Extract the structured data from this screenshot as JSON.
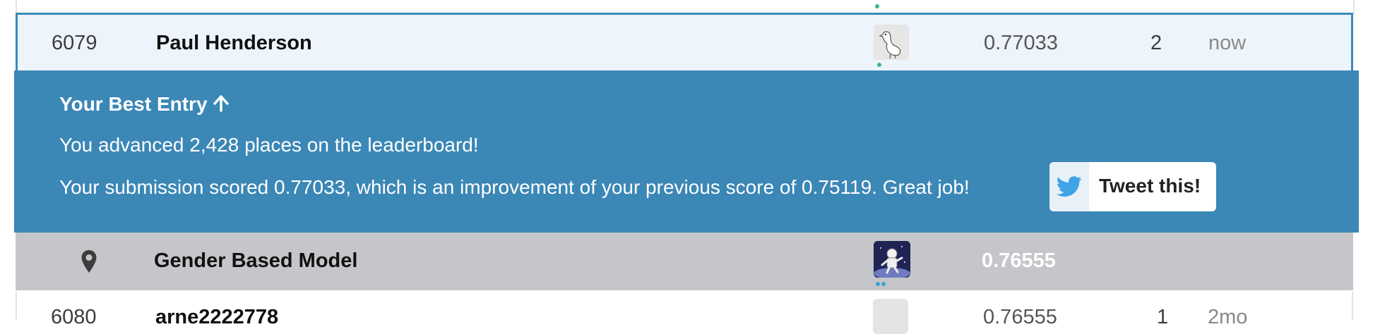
{
  "current_row": {
    "rank": "6079",
    "team": "Paul Henderson",
    "avatar_icon": "goose-avatar-icon",
    "score": "0.77033",
    "entries": "2",
    "last": "now"
  },
  "best_entry": {
    "title": "Your Best Entry",
    "title_icon": "arrow-up-icon",
    "advanced_text": "You advanced 2,428 places on the leaderboard!",
    "score_text": "Your submission scored 0.77033, which is an improvement of your previous score of 0.75119. Great job!",
    "tweet_label": "Tweet this!",
    "tweet_icon": "twitter-bird-icon",
    "background_color": "#3b87b6"
  },
  "benchmark_row": {
    "marker_icon": "map-pin-icon",
    "team": "Gender Based Model",
    "avatar_icon": "astronaut-avatar-icon",
    "score": "0.76555"
  },
  "next_row": {
    "rank": "6080",
    "team": "arne2222778",
    "score": "0.76555",
    "entries": "1",
    "last": "2mo"
  }
}
